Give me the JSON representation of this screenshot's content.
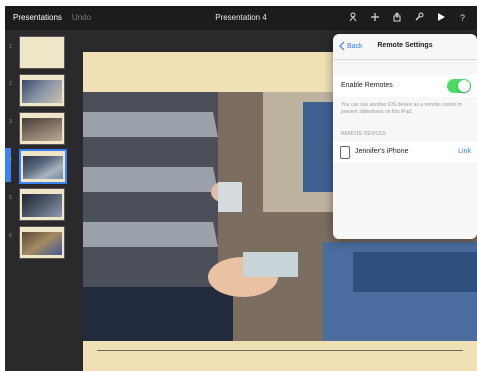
{
  "toolbar": {
    "presentations": "Presentations",
    "undo": "Undo",
    "title": "Presentation 4",
    "icons": [
      "remote-icon",
      "plus-icon",
      "share-icon",
      "wrench-icon",
      "play-icon",
      "help-icon"
    ]
  },
  "slides": {
    "thumbnails": [
      "1",
      "2",
      "3",
      "4",
      "5",
      "6"
    ],
    "selected_index": 4
  },
  "popover": {
    "back": "Back",
    "title": "Remote Settings",
    "enable_remotes": "Enable Remotes",
    "enable_remotes_on": true,
    "note": "You can use another iOS device as a remote control to present slideshows on this iPad.",
    "section": "REMOTE DEVICES",
    "device_name": "Jennifer's iPhone",
    "device_action": "Link"
  },
  "colors": {
    "accent": "#2f7cf6",
    "toggle": "#4cd964"
  }
}
